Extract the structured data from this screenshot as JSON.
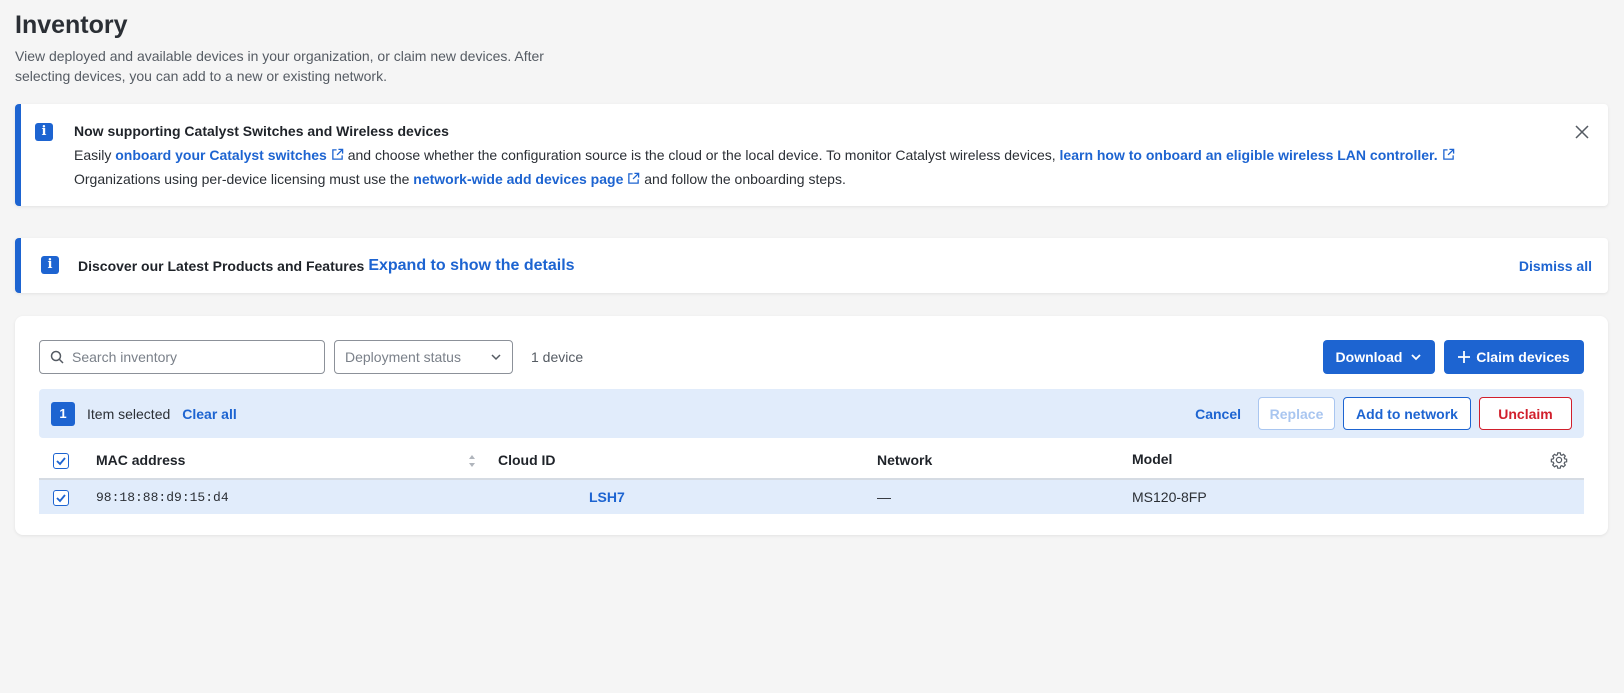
{
  "page": {
    "title": "Inventory",
    "description": "View deployed and available devices in your organization, or claim new devices. After selecting devices, you can add to a new or existing network."
  },
  "banner1": {
    "title": "Now supporting Catalyst Switches and Wireless devices",
    "line1_prefix": "Easily ",
    "link1": "onboard your Catalyst switches",
    "line1_mid": " and choose whether the configuration source is the cloud or the local device. To monitor Catalyst wireless devices, ",
    "link2": "learn how to onboard an eligible wireless LAN controller.",
    "line2_prefix": "Organizations using per-device licensing must use the ",
    "link3": "network-wide add devices page",
    "line2_suffix": " and follow the onboarding steps."
  },
  "banner2": {
    "title": "Discover our Latest Products and Features",
    "expand_link": "Expand to show the details",
    "dismiss": "Dismiss all"
  },
  "toolbar": {
    "search_placeholder": "Search inventory",
    "search_value": "",
    "deployment_status": "Deployment status",
    "device_count": "1 device",
    "download_label": "Download",
    "claim_label": "Claim devices"
  },
  "selection": {
    "count": "1",
    "text": "Item selected",
    "clear_all": "Clear all",
    "cancel": "Cancel",
    "replace": "Replace",
    "add_to_network": "Add to network",
    "unclaim": "Unclaim"
  },
  "table": {
    "columns": {
      "mac": "MAC address",
      "cloud_id": "Cloud ID",
      "network": "Network",
      "model": "Model"
    },
    "rows": [
      {
        "mac": "98:18:88:d9:15:d4",
        "cloud_id": "LSH7",
        "network": "—",
        "model": "MS120-8FP",
        "selected": true
      }
    ]
  },
  "colors": {
    "accent": "#1d64d1",
    "danger": "#d11f2c",
    "selected_bg": "#e1ecfb"
  }
}
